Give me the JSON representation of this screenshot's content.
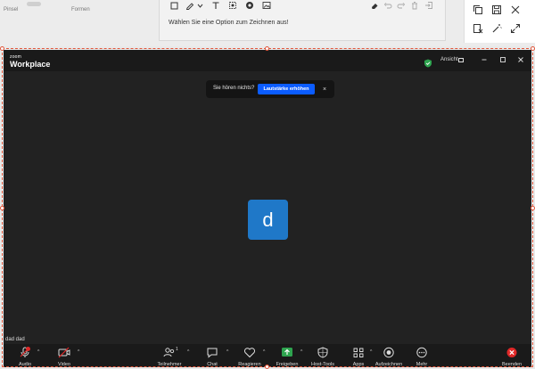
{
  "background": {
    "label_left": "Pinsel",
    "label_mid": "Formen"
  },
  "annotation": {
    "message": "Wählen Sie eine Option zum Zeichnen aus!",
    "tools": [
      "square-icon",
      "pen-icon",
      "chevron-down-icon",
      "text-icon",
      "select-icon",
      "stamp-icon",
      "image-icon",
      "eraser-icon",
      "undo-icon",
      "redo-icon",
      "trash-icon",
      "exit-icon"
    ]
  },
  "right_panel": {
    "icons": [
      "copy-icon",
      "save-icon",
      "close-icon",
      "clear-icon",
      "wand-icon",
      "resize-icon"
    ]
  },
  "zoom": {
    "logo_top": "zoom",
    "logo_main": "Workplace",
    "view_label": "Ansicht",
    "notice": {
      "text": "Sie hören nichts?",
      "button": "Lautstärke erhöhen",
      "close": "×"
    },
    "avatar_letter": "d",
    "participant_name": "dad dad",
    "toolbar": {
      "audio": "Audio",
      "video": "Video",
      "participants": "Teilnehmer",
      "participants_count": "1",
      "chat": "Chat",
      "react": "Reagieren",
      "share": "Freigeben",
      "host_tools": "Host-Tools",
      "apps": "Apps",
      "record": "Aufzeichnen",
      "more": "Mehr",
      "end": "Beenden"
    },
    "colors": {
      "accent": "#0b5cff",
      "share_green": "#2ea44f",
      "end_red": "#e02828",
      "avatar_blue": "#1f78c8"
    }
  }
}
